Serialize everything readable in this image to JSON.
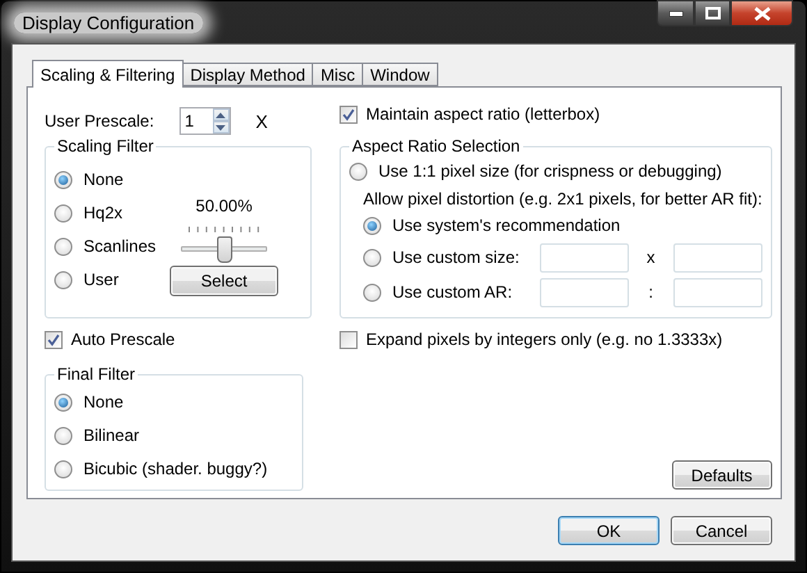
{
  "window": {
    "title": "Display Configuration"
  },
  "tabs": [
    {
      "label": "Scaling & Filtering",
      "selected": true
    },
    {
      "label": "Display Method",
      "selected": false
    },
    {
      "label": "Misc",
      "selected": false
    },
    {
      "label": "Window",
      "selected": false
    }
  ],
  "prescale": {
    "label": "User Prescale:",
    "value": "1",
    "unit": "X"
  },
  "maintain_aspect": {
    "label": "Maintain aspect ratio (letterbox)",
    "checked": true
  },
  "scaling_filter": {
    "title": "Scaling Filter",
    "options": [
      {
        "label": "None",
        "selected": true
      },
      {
        "label": "Hq2x",
        "selected": false
      },
      {
        "label": "Scanlines",
        "selected": false
      },
      {
        "label": "User",
        "selected": false
      }
    ],
    "slider": {
      "reading": "50.00%",
      "level": 0.5
    },
    "select_button": "Select"
  },
  "aspect_ratio": {
    "title": "Aspect Ratio Selection",
    "one_to_one": {
      "label": "Use 1:1 pixel size (for crispness or debugging)",
      "selected": false
    },
    "distortion_label": "Allow pixel distortion (e.g. 2x1 pixels, for better AR fit):",
    "options": [
      {
        "kind": "plain",
        "label": "Use system's recommendation",
        "selected": true
      },
      {
        "kind": "pair",
        "label": "Use custom size:",
        "selected": false,
        "separator": "x"
      },
      {
        "kind": "pair",
        "label": "Use custom AR:",
        "selected": false,
        "separator": ":"
      }
    ]
  },
  "auto_prescale": {
    "label": "Auto Prescale",
    "checked": true
  },
  "expand_integers": {
    "label": "Expand pixels by integers only (e.g. no 1.3333x)",
    "checked": false
  },
  "final_filter": {
    "title": "Final Filter",
    "options": [
      {
        "label": "None",
        "selected": true
      },
      {
        "label": "Bilinear",
        "selected": false
      },
      {
        "label": "Bicubic (shader. buggy?)",
        "selected": false
      }
    ]
  },
  "defaults_button": "Defaults",
  "buttons": [
    {
      "label": "OK",
      "default": true
    },
    {
      "label": "Cancel",
      "default": false
    }
  ]
}
